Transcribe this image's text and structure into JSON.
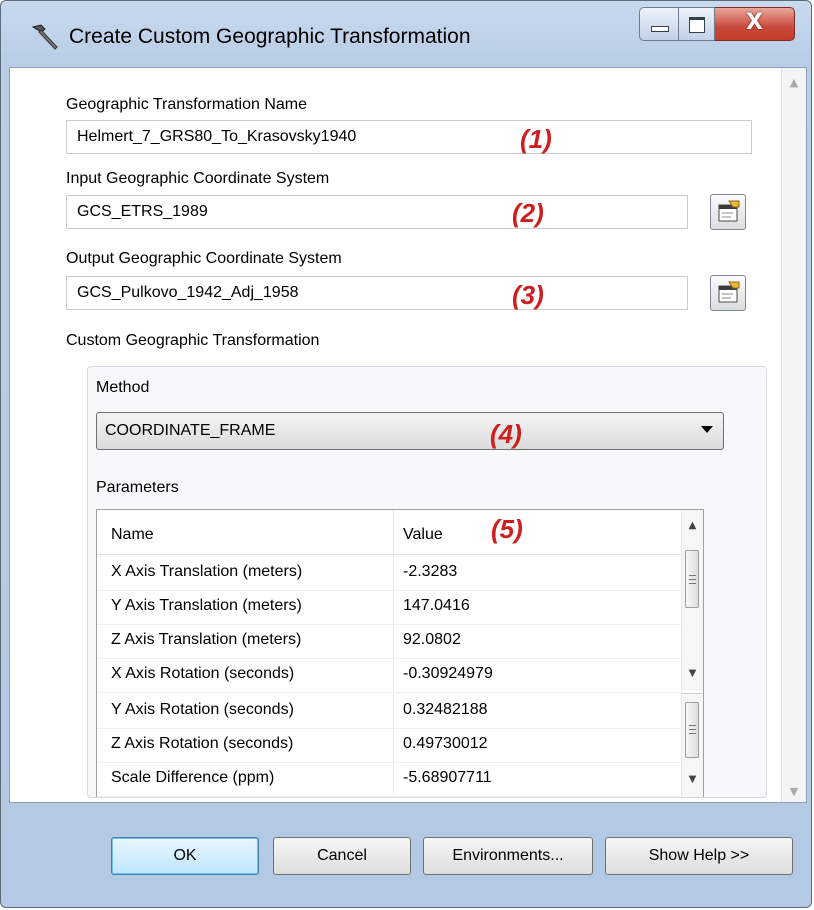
{
  "window": {
    "title": "Create Custom Geographic Transformation",
    "controls": {
      "minimize": "minimize-icon",
      "maximize": "maximize-icon",
      "close": "X"
    }
  },
  "form": {
    "name_label": "Geographic Transformation Name",
    "name_value": "Helmert_7_GRS80_To_Krasovsky1940",
    "input_gcs_label": "Input Geographic Coordinate System",
    "input_gcs_value": "GCS_ETRS_1989",
    "output_gcs_label": "Output Geographic Coordinate System",
    "output_gcs_value": "GCS_Pulkovo_1942_Adj_1958",
    "custom_label": "Custom Geographic Transformation",
    "method_label": "Method",
    "method_value": "COORDINATE_FRAME",
    "parameters_label": "Parameters"
  },
  "markers": {
    "m1": "(1)",
    "m2": "(2)",
    "m3": "(3)",
    "m4": "(4)",
    "m5": "(5)"
  },
  "parameters": {
    "headers": {
      "name": "Name",
      "value": "Value"
    },
    "rows": [
      {
        "name": "X Axis Translation (meters)",
        "value": "-2.3283"
      },
      {
        "name": "Y Axis Translation (meters)",
        "value": "147.0416"
      },
      {
        "name": "Z Axis Translation (meters)",
        "value": "92.0802"
      },
      {
        "name": "X Axis Rotation (seconds)",
        "value": "-0.30924979"
      },
      {
        "name": "Y Axis Rotation (seconds)",
        "value": "0.32482188"
      },
      {
        "name": "Z Axis Rotation (seconds)",
        "value": "0.49730012"
      },
      {
        "name": "Scale Difference (ppm)",
        "value": "-5.68907711"
      }
    ]
  },
  "buttons": {
    "ok": "OK",
    "cancel": "Cancel",
    "environments": "Environments...",
    "help": "Show Help >>"
  },
  "colors": {
    "marker": "#cc1f1f",
    "window_frame": "#b9cde6"
  }
}
